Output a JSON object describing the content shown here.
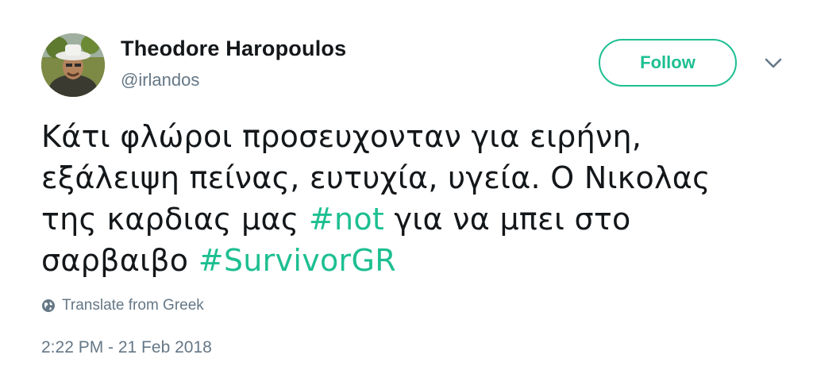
{
  "author": {
    "display_name": "Theodore Haropoulos",
    "handle": "@irlandos"
  },
  "actions": {
    "follow_label": "Follow",
    "accent_color": "#1dbf91"
  },
  "tweet": {
    "line1": "Κάτι φλώροι προσευχονταν για ειρήνη,",
    "line2": "εξάλειψη πείνας, ευτυχία, υγεία. Ο Νικολας",
    "line3_before": "της καρδιας μας ",
    "hashtag_not": "#not",
    "line3_after": " για να μπει στο",
    "line4_before": "σαρβαιβο ",
    "hashtag_survivor": "#SurvivorGR"
  },
  "translate": {
    "label": "Translate from Greek",
    "icon": "globe-icon"
  },
  "meta": {
    "timestamp": "2:22 PM - 21 Feb 2018"
  }
}
